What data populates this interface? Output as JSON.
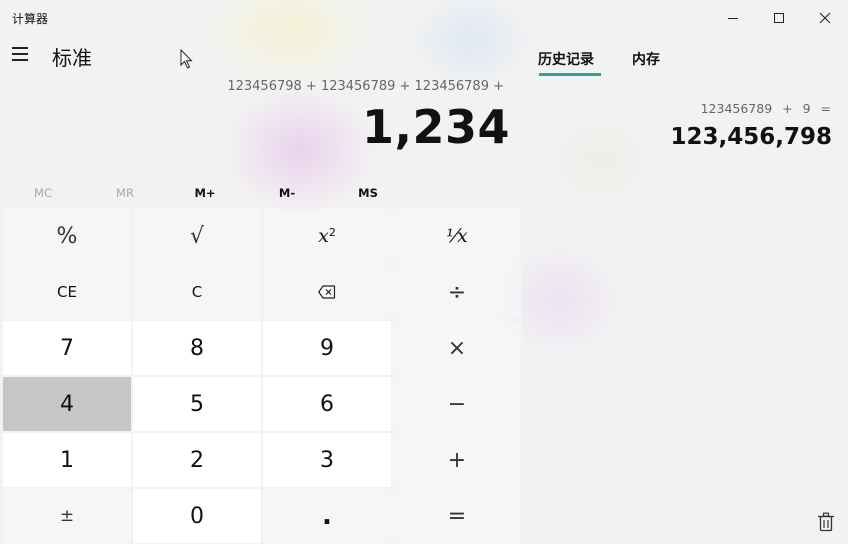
{
  "window": {
    "title": "计算器"
  },
  "header": {
    "mode": "标准"
  },
  "display": {
    "expression": "123456798 + 123456789 + 123456789 +",
    "value": "1,234"
  },
  "memory": {
    "buttons": [
      {
        "label": "MC",
        "enabled": false
      },
      {
        "label": "MR",
        "enabled": false
      },
      {
        "label": "M+",
        "enabled": true
      },
      {
        "label": "M-",
        "enabled": true
      },
      {
        "label": "MS",
        "enabled": true
      }
    ]
  },
  "keys": {
    "percent": "%",
    "sqrt": "√",
    "square_base": "x",
    "square_exp": "2",
    "reciprocal": "⅟x",
    "ce": "CE",
    "c": "C",
    "divide": "÷",
    "seven": "7",
    "eight": "8",
    "nine": "9",
    "multiply": "×",
    "four": "4",
    "five": "5",
    "six": "6",
    "minus": "−",
    "one": "1",
    "two": "2",
    "three": "3",
    "plus": "+",
    "negate": "±",
    "zero": "0",
    "decimal": ".",
    "equals": "="
  },
  "panel": {
    "tabs": [
      "历史记录",
      "内存"
    ],
    "active_tab": "历史记录",
    "accent_color": "#2aa39a",
    "history": [
      {
        "expression": "123456789 + 9 =",
        "result": "123,456,798"
      }
    ]
  }
}
